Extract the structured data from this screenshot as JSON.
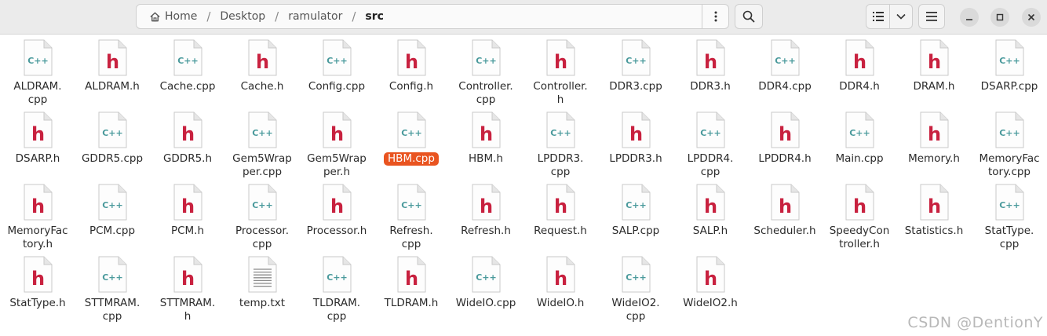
{
  "breadcrumb": [
    "Home",
    "Desktop",
    "ramulator",
    "src"
  ],
  "icons": {
    "home": "home-icon",
    "path_menu": "vertical-dots-icon",
    "search": "search-icon",
    "view_list": "list-view-icon",
    "view_options": "chevron-down-icon",
    "main_menu": "hamburger-menu-icon",
    "minimize": "minimize-icon",
    "maximize": "maximize-icon",
    "close": "close-icon"
  },
  "colors": {
    "selection": "#e95420",
    "header_h": "#c8213f",
    "cpp_text": "#4a9a9c"
  },
  "files": [
    {
      "name": "ALDRAM.\ncpp",
      "type": "cpp"
    },
    {
      "name": "ALDRAM.h",
      "type": "h"
    },
    {
      "name": "Cache.cpp",
      "type": "cpp"
    },
    {
      "name": "Cache.h",
      "type": "h"
    },
    {
      "name": "Config.cpp",
      "type": "cpp"
    },
    {
      "name": "Config.h",
      "type": "h"
    },
    {
      "name": "Controller.\ncpp",
      "type": "cpp"
    },
    {
      "name": "Controller.\nh",
      "type": "h"
    },
    {
      "name": "DDR3.cpp",
      "type": "cpp"
    },
    {
      "name": "DDR3.h",
      "type": "h"
    },
    {
      "name": "DDR4.cpp",
      "type": "cpp"
    },
    {
      "name": "DDR4.h",
      "type": "h"
    },
    {
      "name": "DRAM.h",
      "type": "h"
    },
    {
      "name": "DSARP.cpp",
      "type": "cpp"
    },
    {
      "name": "DSARP.h",
      "type": "h"
    },
    {
      "name": "GDDR5.cpp",
      "type": "cpp"
    },
    {
      "name": "GDDR5.h",
      "type": "h"
    },
    {
      "name": "Gem5Wrap\nper.cpp",
      "type": "cpp"
    },
    {
      "name": "Gem5Wrap\nper.h",
      "type": "h"
    },
    {
      "name": "HBM.cpp",
      "type": "cpp",
      "selected": true
    },
    {
      "name": "HBM.h",
      "type": "h"
    },
    {
      "name": "LPDDR3.\ncpp",
      "type": "cpp"
    },
    {
      "name": "LPDDR3.h",
      "type": "h"
    },
    {
      "name": "LPDDR4.\ncpp",
      "type": "cpp"
    },
    {
      "name": "LPDDR4.h",
      "type": "h"
    },
    {
      "name": "Main.cpp",
      "type": "cpp"
    },
    {
      "name": "Memory.h",
      "type": "h"
    },
    {
      "name": "MemoryFac\ntory.cpp",
      "type": "cpp"
    },
    {
      "name": "MemoryFac\ntory.h",
      "type": "h"
    },
    {
      "name": "PCM.cpp",
      "type": "cpp"
    },
    {
      "name": "PCM.h",
      "type": "h"
    },
    {
      "name": "Processor.\ncpp",
      "type": "cpp"
    },
    {
      "name": "Processor.h",
      "type": "h"
    },
    {
      "name": "Refresh.\ncpp",
      "type": "cpp"
    },
    {
      "name": "Refresh.h",
      "type": "h"
    },
    {
      "name": "Request.h",
      "type": "h"
    },
    {
      "name": "SALP.cpp",
      "type": "cpp"
    },
    {
      "name": "SALP.h",
      "type": "h"
    },
    {
      "name": "Scheduler.h",
      "type": "h"
    },
    {
      "name": "SpeedyCon\ntroller.h",
      "type": "h"
    },
    {
      "name": "Statistics.h",
      "type": "h"
    },
    {
      "name": "StatType.\ncpp",
      "type": "cpp"
    },
    {
      "name": "StatType.h",
      "type": "h"
    },
    {
      "name": "STTMRAM.\ncpp",
      "type": "cpp"
    },
    {
      "name": "STTMRAM.\nh",
      "type": "h"
    },
    {
      "name": "temp.txt",
      "type": "txt"
    },
    {
      "name": "TLDRAM.\ncpp",
      "type": "cpp"
    },
    {
      "name": "TLDRAM.h",
      "type": "h"
    },
    {
      "name": "WideIO.cpp",
      "type": "cpp"
    },
    {
      "name": "WideIO.h",
      "type": "h"
    },
    {
      "name": "WideIO2.\ncpp",
      "type": "cpp"
    },
    {
      "name": "WideIO2.h",
      "type": "h"
    }
  ],
  "watermark": "CSDN @DentionY"
}
